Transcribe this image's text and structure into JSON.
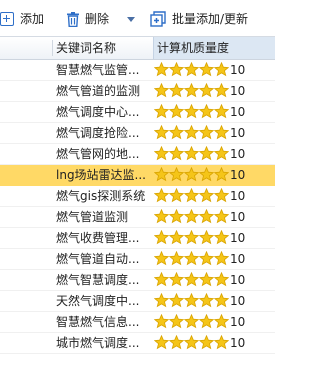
{
  "toolbar": {
    "add_label": "添加",
    "delete_label": "删除",
    "batch_label": "批量添加/更新"
  },
  "table": {
    "columns": [
      "关键词名称",
      "计算机质量度"
    ],
    "selected_index": 5,
    "rows": [
      {
        "name": "智慧燃气监管...",
        "stars": 5,
        "score": "10"
      },
      {
        "name": "燃气管道的监测",
        "stars": 5,
        "score": "10"
      },
      {
        "name": "燃气调度中心...",
        "stars": 5,
        "score": "10"
      },
      {
        "name": "燃气调度抢险...",
        "stars": 5,
        "score": "10"
      },
      {
        "name": "燃气管网的地...",
        "stars": 5,
        "score": "10"
      },
      {
        "name": "lng场站雷达监...",
        "stars": 5,
        "score": "10"
      },
      {
        "name": "燃气gis探测系统",
        "stars": 5,
        "score": "10"
      },
      {
        "name": "燃气管道监测",
        "stars": 5,
        "score": "10"
      },
      {
        "name": "燃气收费管理...",
        "stars": 5,
        "score": "10"
      },
      {
        "name": "燃气管道自动...",
        "stars": 5,
        "score": "10"
      },
      {
        "name": "燃气智慧调度...",
        "stars": 5,
        "score": "10"
      },
      {
        "name": "天然气调度中...",
        "stars": 5,
        "score": "10"
      },
      {
        "name": "智慧燃气信息...",
        "stars": 5,
        "score": "10"
      },
      {
        "name": "城市燃气调度...",
        "stars": 5,
        "score": "10"
      }
    ]
  },
  "colors": {
    "star_fill": "#f5c518",
    "selected_row": "#ffd966",
    "accent": "#2f6fc8"
  }
}
